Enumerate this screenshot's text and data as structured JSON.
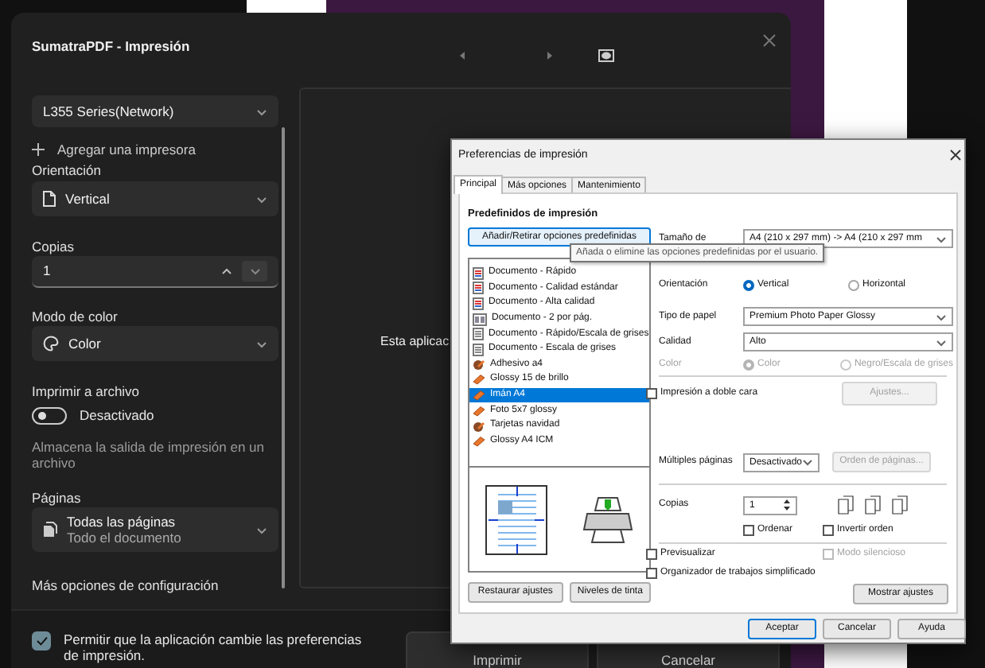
{
  "print_dialog": {
    "title": "SumatraPDF - Impresión",
    "printer": {
      "value": "L355 Series(Network)"
    },
    "add_printer": "Agregar una impresora",
    "orientation": {
      "label": "Orientación",
      "value": "Vertical"
    },
    "copies": {
      "label": "Copias",
      "value": "1"
    },
    "color_mode": {
      "label": "Modo de color",
      "value": "Color"
    },
    "print_to_file": {
      "label": "Imprimir a archivo",
      "on": false,
      "state_text": "Desactivado",
      "description": "Almacena la salida de impresión en un archivo"
    },
    "pages": {
      "label": "Páginas",
      "value": "Todas las páginas",
      "subtext": "Todo el documento"
    },
    "more_settings": "Más opciones de configuración",
    "preview_message": "Esta aplicac",
    "allow_app_preferences": {
      "label": "Permitir que la aplicación cambie las preferencias de impresión.",
      "checked": true
    },
    "buttons": [
      "Imprimir",
      "Cancelar"
    ]
  },
  "preferences_dialog": {
    "title": "Preferencias de impresión",
    "tabs": [
      {
        "label": "Principal",
        "selected": true
      },
      {
        "label": "Más opciones",
        "selected": false
      },
      {
        "label": "Mantenimiento",
        "selected": false
      }
    ],
    "presets": {
      "heading": "Predefinidos de impresión",
      "button": "Añadir/Retirar opciones predefinidas",
      "tooltip": "Añada o elimine las opciones predefinidas por el usuario.",
      "items": [
        {
          "label": "Documento - Rápido",
          "kind": "document",
          "selected": false
        },
        {
          "label": "Documento - Calidad estándar",
          "kind": "document",
          "selected": false
        },
        {
          "label": "Documento - Alta calidad",
          "kind": "document",
          "selected": false
        },
        {
          "label": "Documento - 2 por pág.",
          "kind": "two_up",
          "selected": false
        },
        {
          "label": "Documento - Rápido/Escala de grises",
          "kind": "grayscale",
          "selected": false
        },
        {
          "label": "Documento - Escala de grises",
          "kind": "grayscale",
          "selected": false
        },
        {
          "label": "Adhesivo a4",
          "kind": "custom",
          "selected": false
        },
        {
          "label": "Glossy 15 de brillo",
          "kind": "photo",
          "selected": false
        },
        {
          "label": "Imán A4",
          "kind": "photo",
          "selected": true
        },
        {
          "label": "Foto 5x7 glossy",
          "kind": "photo",
          "selected": false
        },
        {
          "label": "Tarjetas  navidad",
          "kind": "custom",
          "selected": false
        },
        {
          "label": "Glossy A4 ICM",
          "kind": "photo",
          "selected": false
        }
      ]
    },
    "restore_button": "Restaurar ajustes",
    "ink_levels_button": "Niveles de tinta",
    "paper_size": {
      "label": "Tamaño de",
      "value": "A4 (210 x 297 mm) -> A4 (210 x 297 mm"
    },
    "orientation": {
      "label": "Orientación",
      "options": [
        {
          "label": "Vertical",
          "selected": true
        },
        {
          "label": "Horizontal",
          "selected": false
        }
      ]
    },
    "paper_type": {
      "label": "Tipo de papel",
      "value": "Premium Photo Paper Glossy"
    },
    "quality": {
      "label": "Calidad",
      "value": "Alto"
    },
    "color": {
      "label": "Color",
      "disabled": true,
      "options": [
        {
          "label": "Color",
          "selected": true
        },
        {
          "label": "Negro/Escala de grises",
          "selected": false
        }
      ]
    },
    "duplex": {
      "label": "Impresión a doble cara",
      "checked": false,
      "button": {
        "label": "Ajustes...",
        "disabled": true
      }
    },
    "multiple_pages": {
      "label": "Múltiples páginas",
      "value": "Desactivado",
      "button": {
        "label": "Orden de páginas...",
        "disabled": true
      }
    },
    "copies": {
      "label": "Copias",
      "value": "1"
    },
    "collate_options": [
      {
        "label": "Ordenar",
        "checked": false,
        "disabled": false
      },
      {
        "label": "Invertir orden",
        "checked": false,
        "disabled": false
      }
    ],
    "preview_options": [
      {
        "label": "Previsualizar",
        "checked": false,
        "disabled": false
      },
      {
        "label": "Modo silencioso",
        "checked": false,
        "disabled": true
      }
    ],
    "job_arranger": {
      "label": "Organizador de trabajos simplificado",
      "checked": false
    },
    "show_settings_button": "Mostrar ajustes",
    "buttons": [
      "Aceptar",
      "Cancelar",
      "Ayuda"
    ]
  }
}
